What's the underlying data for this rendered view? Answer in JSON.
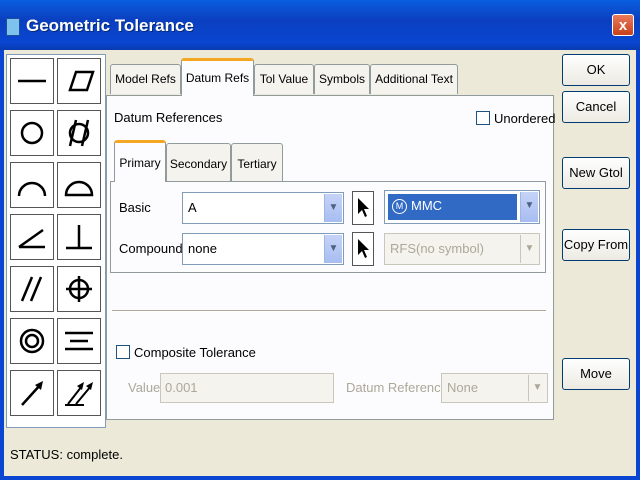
{
  "window": {
    "title": "Geometric Tolerance",
    "close_label": "x"
  },
  "palette": {
    "symbols": [
      "straightness-icon",
      "flatness-icon",
      "circularity-icon",
      "cylindricity-icon",
      "profile-line-icon",
      "profile-surface-icon",
      "angularity-icon",
      "perpendicularity-icon",
      "parallelism-icon",
      "position-icon",
      "concentricity-icon",
      "symmetry-icon",
      "circular-runout-icon",
      "total-runout-icon"
    ]
  },
  "tabs": [
    "Model Refs",
    "Datum Refs",
    "Tol Value",
    "Symbols",
    "Additional Text"
  ],
  "active_tab": "Datum Refs",
  "datum": {
    "section_label": "Datum References",
    "unordered_label": "Unordered",
    "unordered_checked": false,
    "inner_tabs": [
      "Primary",
      "Secondary",
      "Tertiary"
    ],
    "active_inner_tab": "Primary",
    "basic_label": "Basic",
    "basic_value": "A",
    "compound_label": "Compound",
    "compound_value": "none",
    "material_value": "MMC",
    "material_badge": "M",
    "compound_material_value": "RFS(no symbol)"
  },
  "composite": {
    "label": "Composite Tolerance",
    "checked": false,
    "value_label": "Value",
    "value": "0.001",
    "datum_ref_label": "Datum Reference",
    "datum_ref_value": "None"
  },
  "buttons": {
    "ok": "OK",
    "cancel": "Cancel",
    "new_gtol": "New Gtol",
    "copy_from": "Copy From",
    "move": "Move"
  },
  "status": "STATUS: complete."
}
